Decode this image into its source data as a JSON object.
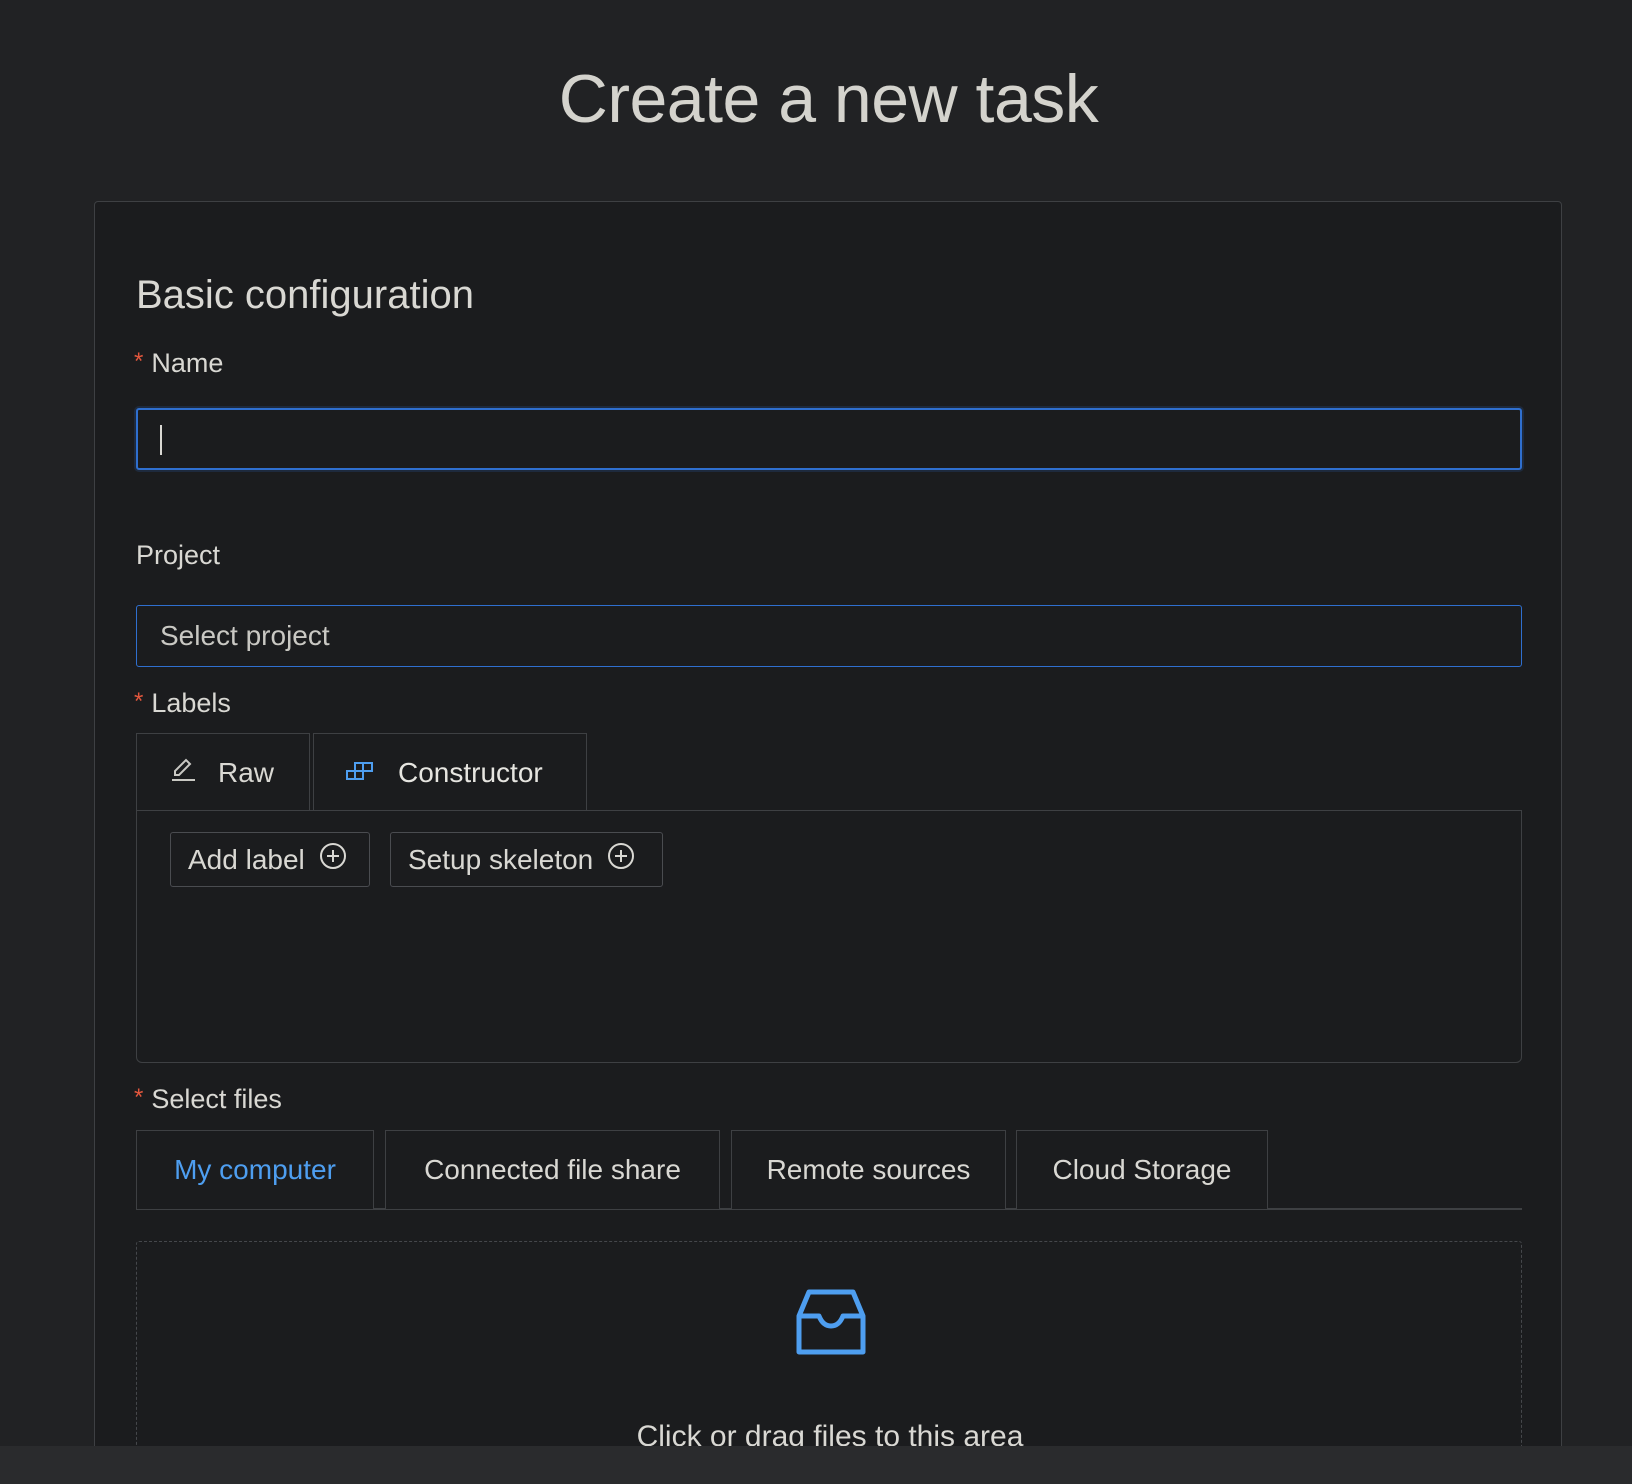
{
  "page": {
    "title": "Create a new task"
  },
  "form": {
    "section_title": "Basic configuration",
    "name": {
      "label": "Name",
      "required_mark": "*",
      "value": ""
    },
    "project": {
      "label": "Project",
      "placeholder": "Select project"
    },
    "labels": {
      "label": "Labels",
      "required_mark": "*",
      "tabs": [
        {
          "label": "Raw",
          "icon": "edit-icon"
        },
        {
          "label": "Constructor",
          "icon": "blocks-icon",
          "active": true
        }
      ],
      "buttons": [
        {
          "label": "Add label",
          "icon": "plus-circle-icon"
        },
        {
          "label": "Setup skeleton",
          "icon": "plus-circle-icon"
        }
      ]
    },
    "files": {
      "label": "Select files",
      "required_mark": "*",
      "tabs": [
        {
          "label": "My computer",
          "active": true
        },
        {
          "label": "Connected file share"
        },
        {
          "label": "Remote sources"
        },
        {
          "label": "Cloud Storage"
        }
      ],
      "dropzone": {
        "icon": "inbox-icon",
        "text": "Click or drag files to this area"
      }
    }
  },
  "colors": {
    "accent": "#4e9ef0",
    "required": "#e3573d",
    "focus_border": "#2f6fcf",
    "background": "#212224",
    "card": "#1b1c1e"
  }
}
